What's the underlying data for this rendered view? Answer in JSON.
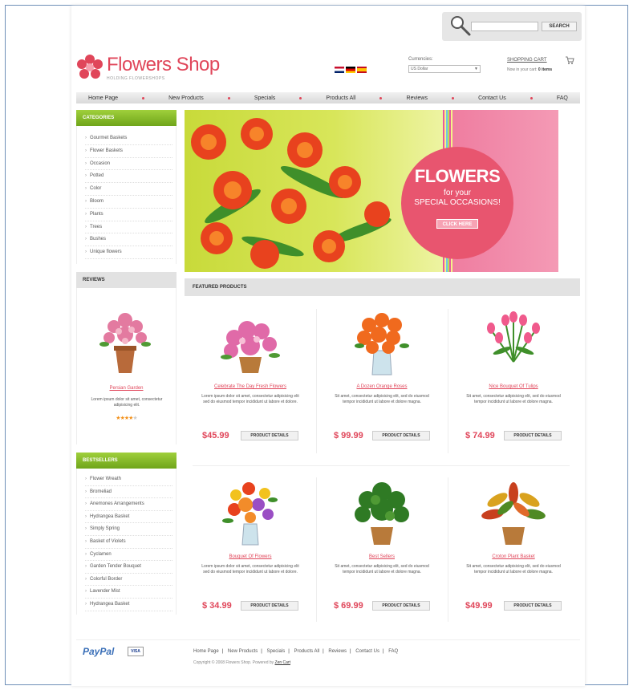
{
  "search": {
    "placeholder": "",
    "button_label": "SEARCH"
  },
  "header": {
    "logo_text": "Flowers Shop",
    "tagline": "HOLDING FLOWERSHOPS",
    "currencies_label": "Currencies:",
    "currency_value": "US Dollar",
    "cart_link": "SHOPPING CART",
    "cart_status_prefix": "Now in your cart",
    "cart_status_items": "0 items"
  },
  "nav": [
    "Home Page",
    "New Products",
    "Specials",
    "Products All",
    "Reviews",
    "Contact Us",
    "FAQ"
  ],
  "categories": {
    "title": "CATEGORIES",
    "items": [
      "Gourmet Baskets",
      "Flower Baskets",
      "Occasion",
      "Potted",
      "Color",
      "Bloom",
      "Plants",
      "Trees",
      "Bushes",
      "Unique flowers"
    ]
  },
  "reviews": {
    "title": "REVIEWS",
    "product": "Persian Garden",
    "text": "Lorem ipsum dolor sit amet, consectetur adipisicing elit.",
    "rating": 4,
    "max_rating": 5
  },
  "bestsellers": {
    "title": "BESTSELLERS",
    "items": [
      "Flower Wreath",
      "Bromeliad",
      "Anemones Arrangements",
      "Hydrangea Basket",
      "Simply Spring",
      "Basket of Violets",
      "Cyclamen",
      "Garden Tender Bouquet",
      "Colorful Border",
      "Lavender Mist",
      "Hydrangea Basket"
    ]
  },
  "banner": {
    "title": "FLOWERS",
    "line1": "for your",
    "line2": "SPECIAL OCCASIONS!",
    "button": "CLICK HERE"
  },
  "featured": {
    "title": "FEATURED PRODUCTS",
    "details_label": "PRODUCT DETAILS",
    "products": [
      {
        "name": "Celebrate The Day Fresh Flowers",
        "desc": "Lorem ipsum dolor sit amet, consectetur adipisicing elit sed do eiusmod tempor incididunt ut labore et dolore.",
        "price": "$45.99"
      },
      {
        "name": "A Dozen Orange Roses",
        "desc": "Sit amet, consectetur adipisicing elit, sed do eiusmod tempor incididunt ut labore et dolore magna.",
        "price": "$ 99.99"
      },
      {
        "name": "Nice Bouquet Of Tulips",
        "desc": "Sit amet, consectetur adipisicing elit, sed do eiusmod tempor incididunt ut labore et dolore magna.",
        "price": "$ 74.99"
      },
      {
        "name": "Bouquet Of Flowers",
        "desc": "Lorem ipsum dolor sit amet, consectetur adipisicing elit sed do eiusmod tempor incididunt ut labore et dolore.",
        "price": "$ 34.99"
      },
      {
        "name": "Best Sellers",
        "desc": "Sit amet, consectetur adipisicing elit, sed do eiusmod tempor incididunt ut labore et dolore magna.",
        "price": "$ 69.99"
      },
      {
        "name": "Croton Plant Basket",
        "desc": "Sit amet, consectetur adipisicing elit, sed do eiusmod tempor incididunt ut labore et dolore magna.",
        "price": "$49.99"
      }
    ]
  },
  "footer": {
    "paypal": "PayPal",
    "visa": "VISA",
    "links": [
      "Home Page",
      "New Products",
      "Specials",
      "Products All",
      "Reviews",
      "Contact Us",
      "FAQ"
    ],
    "copyright_prefix": "Copyright © 2008 Flowers Shop.",
    "powered_label": "Powered by",
    "powered_by": "Zen Cart"
  },
  "colors": {
    "accent": "#e0465a",
    "green": "#8cc63f",
    "nav_bg": "#dddddd"
  }
}
